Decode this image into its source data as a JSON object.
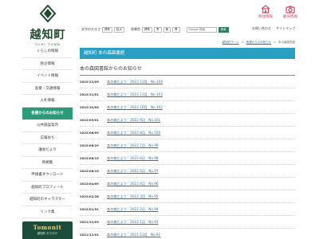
{
  "header": {
    "logo_name": "越知町",
    "logo_en": "OCHI TOWN",
    "font_size_label": "文字の大きさ",
    "font_sizes": [
      "標準",
      "拡大"
    ],
    "bg_color_label": "背景色",
    "bg_colors": [
      "標準",
      "青",
      "黄",
      "黒"
    ],
    "search_placeholder": "Google 検索",
    "search_button": "検索",
    "quick_links": [
      {
        "label": "移住情報",
        "icon": "house-icon"
      },
      {
        "label": "観光情報",
        "icon": "camera-icon"
      }
    ],
    "util_links": [
      "お問い合わせ",
      "サイトマップ"
    ]
  },
  "breadcrumb": {
    "items": [
      "越知町ホーム",
      "各課からのお知らせ",
      "本の森図書館"
    ]
  },
  "sidebar": {
    "items": [
      {
        "label": "くらしの情報",
        "active": false
      },
      {
        "label": "防災情報",
        "active": false
      },
      {
        "label": "イベント情報",
        "active": false
      },
      {
        "label": "産業・交通情報",
        "active": false
      },
      {
        "label": "入札情報",
        "active": false
      },
      {
        "label": "各課からのお知らせ",
        "active": true
      },
      {
        "label": "公共施設案内",
        "active": false
      },
      {
        "label": "広報おち",
        "active": false
      },
      {
        "label": "議会だより",
        "active": false
      },
      {
        "label": "例規集",
        "active": false
      },
      {
        "label": "申請書ダウンロード",
        "active": false
      },
      {
        "label": "越知町プロフィール",
        "active": false
      },
      {
        "label": "越知町のキャラクター",
        "active": false
      },
      {
        "label": "リンク集",
        "active": false
      }
    ],
    "banner_title": "Tomonit",
    "banner_sub": "越知町 おでかけ"
  },
  "main": {
    "page_title": "越知町 本の森図書館",
    "section_title": "本の森図書館からのお知らせ",
    "news": [
      {
        "date": "2022/12/05",
        "title": "本の森だより　2022.12月　No.104"
      },
      {
        "date": "2022/11/01",
        "title": "本の森だより　2022.11月　No.103"
      },
      {
        "date": "2022/10/04",
        "title": "本の森だより　2022.10月　No.102"
      },
      {
        "date": "2022/09/01",
        "title": "本の森だより　2022.9月　No.101"
      },
      {
        "date": "2022/08/09",
        "title": "本の森だより　2022.8月　No.100"
      },
      {
        "date": "2022/06/29",
        "title": "本の森だより　2022.7月　No.99"
      },
      {
        "date": "2022/06/15",
        "title": "本の森だより　2022.6月　No.98"
      },
      {
        "date": "2022/06/15",
        "title": "本の森だより　2022.5月　No.97"
      },
      {
        "date": "2022/04/09",
        "title": "本の森だより　2022.4月　No.96"
      },
      {
        "date": "2022/02/28",
        "title": "本の森だより　2022.3月　No.95"
      },
      {
        "date": "2022/01/31",
        "title": "本の森だより　2022.2月　No.94"
      },
      {
        "date": "2021/12/03",
        "title": "本の森だより　2022.1月　No.93"
      },
      {
        "date": "2021/12/01",
        "title": "本の森だより　2021.12月　No.92"
      }
    ]
  },
  "colors": {
    "accent_green": "#2d9a7b",
    "heading_blue": "#2a9fc2",
    "link_blue": "#2f6ea8",
    "quick_link_pink": "#c94c63",
    "logo_green": "#1f4a2e"
  }
}
